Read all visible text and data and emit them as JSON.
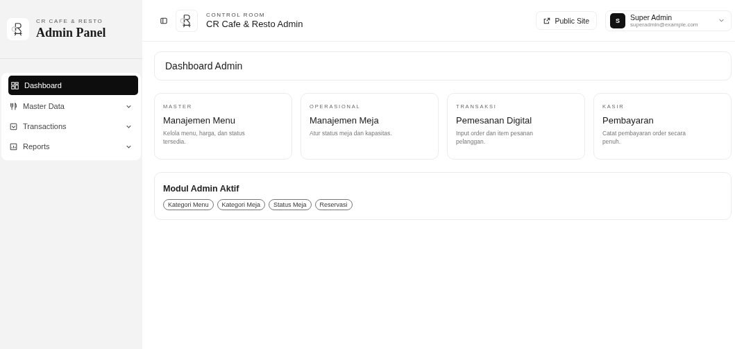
{
  "sidebar": {
    "brand_kicker": "CR CAFE & RESTO",
    "brand_title": "Admin Panel",
    "nav": [
      {
        "label": "Dashboard",
        "selected": true,
        "has_submenu": false
      },
      {
        "label": "Master Data",
        "selected": false,
        "has_submenu": true
      },
      {
        "label": "Transactions",
        "selected": false,
        "has_submenu": true
      },
      {
        "label": "Reports",
        "selected": false,
        "has_submenu": true
      }
    ]
  },
  "topbar": {
    "kicker": "CONTROL ROOM",
    "title": "CR Cafe & Resto Admin",
    "public_site": "Public Site",
    "user": {
      "initial": "S",
      "name": "Super Admin",
      "email": "superadmin@example.com"
    }
  },
  "page_title": "Dashboard Admin",
  "cards": [
    {
      "kicker": "MASTER",
      "title": "Manajemen Menu",
      "text": "Kelola menu, harga, dan status tersedia."
    },
    {
      "kicker": "OPERASIONAL",
      "title": "Manajemen Meja",
      "text": "Atur status meja dan kapasitas."
    },
    {
      "kicker": "TRANSAKSI",
      "title": "Pemesanan Digital",
      "text": "Input order dan item pesanan pelanggan."
    },
    {
      "kicker": "KASIR",
      "title": "Pembayaran",
      "text": "Catat pembayaran order secara penuh."
    }
  ],
  "modules": {
    "title": "Modul Admin Aktif",
    "tags": [
      "Kategori Menu",
      "Kategori Meja",
      "Status Meja",
      "Reservasi"
    ]
  }
}
